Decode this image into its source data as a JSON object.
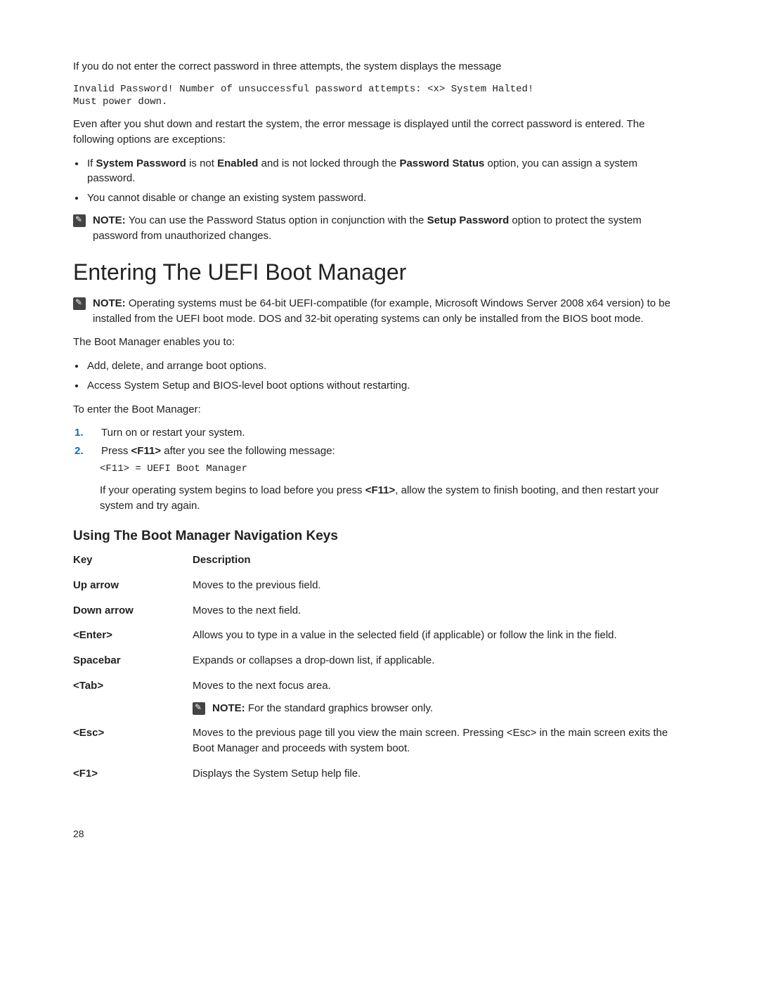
{
  "top": {
    "line1": "If you do not enter the correct password in three attempts, the system displays the message",
    "code1": "Invalid Password! Number of unsuccessful password attempts: <x> System Halted!\nMust power down.",
    "line2": "Even after you shut down and restart the system, the error message is displayed until the correct password is entered. The following options are exceptions:",
    "bullet1_pre": "If ",
    "bullet1_b1": "System Password",
    "bullet1_mid1": " is not ",
    "bullet1_b2": "Enabled",
    "bullet1_mid2": " and is not locked through the ",
    "bullet1_b3": "Password Status",
    "bullet1_post": " option, you can assign a system password.",
    "bullet2": "You cannot disable or change an existing system password.",
    "note1_bold": "NOTE: ",
    "note1_pre": "You can use the Password Status option in conjunction with the ",
    "note1_b": "Setup Password",
    "note1_post": " option to protect the system password from unauthorized changes."
  },
  "uefi": {
    "heading": "Entering The UEFI Boot Manager",
    "note2_bold": "NOTE: ",
    "note2_text": "Operating systems must be 64-bit UEFI-compatible (for example, Microsoft Windows Server 2008 x64 version) to be installed from the UEFI boot mode. DOS and 32-bit operating systems can only be installed from the BIOS boot mode.",
    "intro1": "The Boot Manager enables you to:",
    "b1": "Add, delete, and arrange boot options.",
    "b2": "Access System Setup and BIOS-level boot options without restarting.",
    "intro2": "To enter the Boot Manager:",
    "step1": "Turn on or restart your system.",
    "step2_pre": "Press ",
    "step2_b": "<F11>",
    "step2_post": " after you see the following message:",
    "step2_code": "<F11> = UEFI Boot Manager",
    "step2_p_pre": "If your operating system begins to load before you press ",
    "step2_p_b": "<F11>",
    "step2_p_post": ", allow the system to finish booting, and then restart your system and try again."
  },
  "nav": {
    "heading": "Using The Boot Manager Navigation Keys",
    "col1": "Key",
    "col2": "Description",
    "rows": [
      {
        "k": "Up arrow",
        "d": "Moves to the previous field."
      },
      {
        "k": "Down arrow",
        "d": "Moves to the next field."
      },
      {
        "k": "<Enter>",
        "d": "Allows you to type in a value in the selected field (if applicable) or follow the link in the field."
      },
      {
        "k": "Spacebar",
        "d": "Expands or collapses a drop-down list, if applicable."
      }
    ],
    "tab_k": "<Tab>",
    "tab_d": "Moves to the next focus area.",
    "tab_note_bold": "NOTE: ",
    "tab_note": "For the standard graphics browser only.",
    "esc_k": "<Esc>",
    "esc_d": "Moves to the previous page till you view the main screen. Pressing <Esc> in the main screen exits the Boot Manager and proceeds with system boot.",
    "f1_k": "<F1>",
    "f1_d": "Displays the System Setup help file."
  },
  "page_num": "28"
}
